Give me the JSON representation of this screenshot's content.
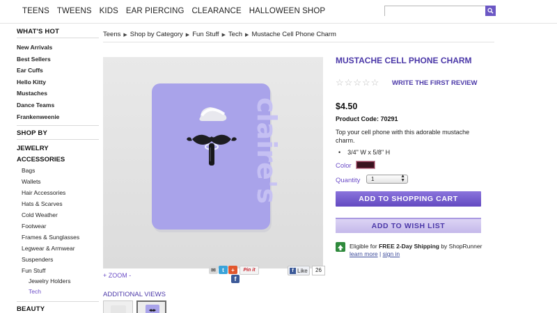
{
  "topnav": {
    "links": [
      "TEENS",
      "TWEENS",
      "KIDS",
      "EAR PIERCING",
      "CLEARANCE",
      "HALLOWEEN SHOP"
    ],
    "search_value": ""
  },
  "sidebar": {
    "whats_hot_heading": "WHAT'S HOT",
    "hot_items": [
      "New Arrivals",
      "Best Sellers",
      "Ear Cuffs",
      "Hello Kitty",
      "Mustaches",
      "Dance Teams",
      "Frankenweenie"
    ],
    "shop_by_heading": "SHOP BY",
    "category_title_1": "JEWELRY",
    "category_title_2": "ACCESSORIES",
    "accessories": [
      "Bags",
      "Wallets",
      "Hair Accessories",
      "Hats & Scarves",
      "Cold Weather",
      "Footwear",
      "Frames & Sunglasses",
      "Legwear & Armwear",
      "Suspenders",
      "Fun Stuff"
    ],
    "fun_stuff_children": [
      "Jewelry Holders",
      "Tech"
    ],
    "next_category": "BEAUTY"
  },
  "breadcrumb": [
    "Teens",
    "Shop by Category",
    "Fun Stuff",
    "Tech",
    "Mustache Cell Phone Charm"
  ],
  "product": {
    "title": "MUSTACHE CELL PHONE CHARM",
    "rating_stars": 0,
    "review_link": "WRITE THE FIRST REVIEW",
    "price": "$4.50",
    "code": "Product Code: 70291",
    "description": "Top your cell phone with this adorable mustache charm.",
    "dimensions": "3/4\" W x 5/8\" H",
    "color_label": "Color",
    "color_value_hex": "#3a1420",
    "quantity_label": "Quantity",
    "quantity_value": "1",
    "add_to_cart": "ADD TO SHOPPING CART",
    "add_to_wish": "ADD TO WISH LIST",
    "card_brand_text": "claire's"
  },
  "image_controls": {
    "zoom": "+ ZOOM -",
    "pin_it": "Pin it",
    "like": "Like",
    "like_count": "26"
  },
  "shipping": {
    "prefix": "Eligible for ",
    "bold": "FREE 2-Day Shipping",
    "suffix": " by ShopRunner",
    "learn_more": "learn more",
    "sign_in": "sign in",
    "divider": " | "
  },
  "additional_views": {
    "title": "ADDITIONAL VIEWS"
  },
  "colors": {
    "accent": "#4b38a8",
    "cart_button": "#6b57c4",
    "card_lavender": "#a9a3ea"
  }
}
